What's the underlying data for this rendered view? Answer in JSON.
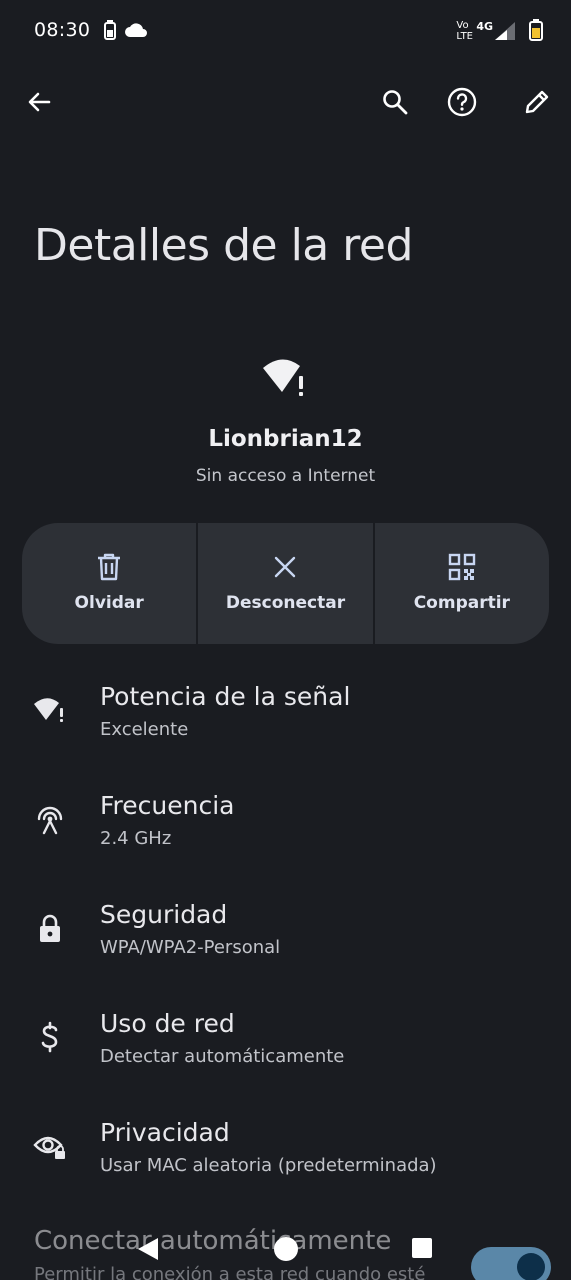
{
  "status_bar": {
    "time": "08:30",
    "volte_top": "Vo",
    "volte_bottom": "LTE",
    "network": "4G"
  },
  "app_bar": {
    "back_icon": "arrow-back-icon",
    "search_icon": "search-icon",
    "help_icon": "help-icon",
    "edit_icon": "edit-icon"
  },
  "page": {
    "title": "Detalles de la red"
  },
  "network": {
    "name": "Lionbrian12",
    "status": "Sin acceso a Internet"
  },
  "actions": [
    {
      "label": "Olvidar",
      "icon": "trash-icon"
    },
    {
      "label": "Desconectar",
      "icon": "close-icon"
    },
    {
      "label": "Compartir",
      "icon": "qr-code-icon"
    }
  ],
  "details": [
    {
      "title": "Potencia de la señal",
      "subtitle": "Excelente",
      "icon": "wifi-alert-icon"
    },
    {
      "title": "Frecuencia",
      "subtitle": "2.4 GHz",
      "icon": "antenna-icon"
    },
    {
      "title": "Seguridad",
      "subtitle": "WPA/WPA2-Personal",
      "icon": "lock-icon"
    },
    {
      "title": "Uso de red",
      "subtitle": "Detectar automáticamente",
      "icon": "dollar-icon"
    },
    {
      "title": "Privacidad",
      "subtitle": "Usar MAC aleatoria (predeterminada)",
      "icon": "eye-lock-icon"
    }
  ],
  "auto_connect": {
    "title": "Conectar automáticamente",
    "subtitle": "Permitir la conexión a esta red cuando esté",
    "enabled": true
  },
  "colors": {
    "background": "#1a1c21",
    "card": "#2d3036",
    "toggle_track": "#5a87a8",
    "toggle_knob": "#0d2f49"
  }
}
